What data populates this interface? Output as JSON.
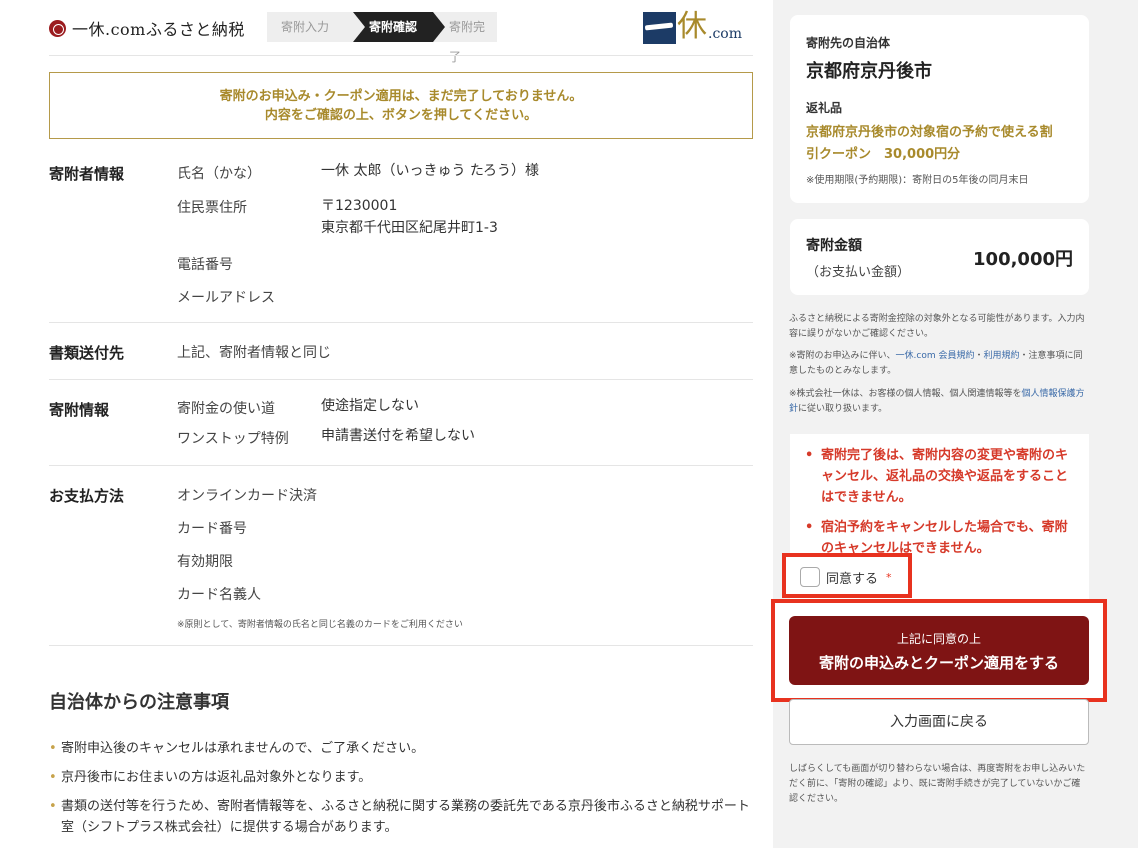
{
  "header": {
    "site_name": "一休.comふるさと納税",
    "steps": [
      "寄附入力",
      "寄附確認",
      "寄附完了"
    ],
    "active_step": "寄附確認",
    "brand_kanji": "休",
    "brand_suffix": ".com"
  },
  "notice": {
    "line1": "寄附のお申込み・クーポン適用は、まだ完了しておりません。",
    "line2": "内容をご確認の上、ボタンを押してください。"
  },
  "donor": {
    "title": "寄附者情報",
    "name_label": "氏名（かな）",
    "name_value": "一休 太郎（いっきゅう たろう）様",
    "address_label": "住民票住所",
    "postal": "〒1230001",
    "address": "東京都千代田区紀尾井町1-3",
    "phone_label": "電話番号",
    "email_label": "メールアドレス"
  },
  "shipping": {
    "title": "書類送付先",
    "value": "上記、寄附者情報と同じ"
  },
  "donation": {
    "title": "寄附情報",
    "use_label": "寄附金の使い道",
    "use_value": "使途指定しない",
    "onestop_label": "ワンストップ特例",
    "onestop_value": "申請書送付を希望しない"
  },
  "payment": {
    "title": "お支払方法",
    "method": "オンラインカード決済",
    "card_number_label": "カード番号",
    "expiry_label": "有効期限",
    "holder_label": "カード名義人",
    "note": "※原則として、寄附者情報の氏名と同じ名義のカードをご利用ください"
  },
  "notes": {
    "title": "自治体からの注意事項",
    "items": [
      "寄附申込後のキャンセルは承れませんので、ご了承ください。",
      "京丹後市にお住まいの方は返礼品対象外となります。",
      "書類の送付等を行うため、寄附者情報等を、ふるさと納税に関する業務の委託先である京丹後市ふるさと納税サポート室（シフトプラス株式会社）に提供する場合があります。"
    ]
  },
  "summary": {
    "municipality_label": "寄附先の自治体",
    "municipality": "京都府京丹後市",
    "gift_label": "返礼品",
    "gift_line1": "京都府京丹後市の対象宿の予約で使える割",
    "gift_line2": "引クーポン　30,000円分",
    "gift_expiry": "※使用期限(予約期限)：寄附日の5年後の同月末日",
    "amount_label": "寄附金額",
    "amount_sub": "（お支払い金額）",
    "amount_value": "100,000円"
  },
  "fine_print": {
    "p1": "ふるさと納税による寄附金控除の対象外となる可能性があります。入力内容に誤りがないかご確認ください。",
    "p2_a": "※寄附のお申込みに伴い、",
    "p2_link1": "一休.com 会員規約",
    "p2_mid": "・",
    "p2_link2": "利用規約",
    "p2_b": "・注意事項に同意したものとみなします。",
    "p3_a": "※株式会社一休は、お客様の個人情報、個人関連情報等を",
    "p3_link": "個人情報保護方針",
    "p3_b": "に従い取り扱います。"
  },
  "warnings": [
    "寄附完了後は、寄附内容の変更や寄附のキャンセル、返礼品の交換や返品をすることはできません。",
    "宿泊予約をキャンセルした場合でも、寄附のキャンセルはできません。"
  ],
  "agree": {
    "label": "同意する",
    "required_mark": "*"
  },
  "buttons": {
    "submit_line1": "上記に同意の上",
    "submit_line2": "寄附の申込みとクーポン適用をする",
    "back": "入力画面に戻る"
  },
  "bottom_note": "しばらくしても画面が切り替わらない場合は、再度寄附をお申し込みいただく前に、「寄附の確認」より、既に寄附手続きが完了していないかご確認ください。"
}
